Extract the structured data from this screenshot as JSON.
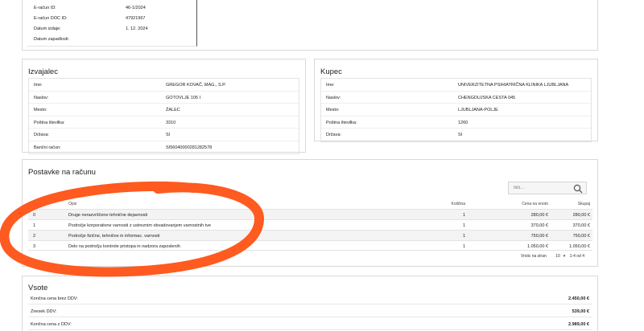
{
  "meta": {
    "rows": [
      {
        "label": "E-račun ID:",
        "value": "46-1/2024"
      },
      {
        "label": "E-račun DOC ID:",
        "value": "47921967"
      },
      {
        "label": "Datum izdaje:",
        "value": "1. 12. 2024"
      },
      {
        "label": "Datum zapadlosti:",
        "value": ""
      }
    ]
  },
  "seller": {
    "title": "Izvajalec",
    "rows": [
      {
        "label": "Ime:",
        "value": "GREGOR KOVAČ, MAG., S.P."
      },
      {
        "label": "Naslov:",
        "value": "GOTOVLJE 105 I"
      },
      {
        "label": "Mesto:",
        "value": "ŽALEC"
      },
      {
        "label": "Poštna številka:",
        "value": "3310"
      },
      {
        "label": "Država:",
        "value": "SI"
      },
      {
        "label": "Bančni račun:",
        "value": "SI56040000281282578"
      }
    ]
  },
  "buyer": {
    "title": "Kupec",
    "rows": [
      {
        "label": "Ime:",
        "value": "UNIVERZITETNA PSIHIATRIČNA KLINIKA LJUBLJANA"
      },
      {
        "label": "Naslov:",
        "value": "CHENGDUJSKA CESTA 045"
      },
      {
        "label": "Mesto:",
        "value": "LJUBLJANA-POLJE"
      },
      {
        "label": "Poštna številka:",
        "value": "1260"
      },
      {
        "label": "Država:",
        "value": "SI"
      }
    ]
  },
  "items": {
    "title": "Postavke na računu",
    "search_placeholder": "Išči...",
    "headers": {
      "num": "# ↑",
      "opis": "Opis",
      "kolicina": "Količina",
      "cena": "Cena na enoto",
      "skupaj": "Skupaj"
    },
    "rows": [
      {
        "num": "0",
        "opis": "Druge nerazvrščene tehnične dejavnosti",
        "kolicina": "1",
        "cena": "280,00 €",
        "skupaj": "280,00 €"
      },
      {
        "num": "1",
        "opis": "Področje korporativne varnosti z ustreznim obvadovanjem varnostnih tve",
        "kolicina": "1",
        "cena": "370,00 €",
        "skupaj": "370,00 €"
      },
      {
        "num": "2",
        "opis": "Področje fizične, tehnične in informac. varnosti",
        "kolicina": "1",
        "cena": "750,00 €",
        "skupaj": "750,00 €"
      },
      {
        "num": "3",
        "opis": "Delo na področju kontrole pristopa in nadzora zaposlenih",
        "kolicina": "1",
        "cena": "1.050,00 €",
        "skupaj": "1.050,00 €"
      }
    ],
    "pager": {
      "rows_label": "Vrstic na stran",
      "rows_value": "10",
      "range": "1-4 od 4"
    }
  },
  "totals": {
    "title": "Vsote",
    "rows": [
      {
        "label": "Končna cena brez DDV:",
        "value": "2.450,00 €"
      },
      {
        "label": "Znesek DDV:",
        "value": "539,00 €"
      },
      {
        "label": "Končna cena z DDV:",
        "value": "2.989,00 €"
      }
    ]
  },
  "colors": {
    "annotation": "#ff5a1f",
    "border": "#d9d9d9"
  },
  "icons": [
    "search-icon",
    "sort-arrow-icon",
    "chevron-down-icon"
  ]
}
